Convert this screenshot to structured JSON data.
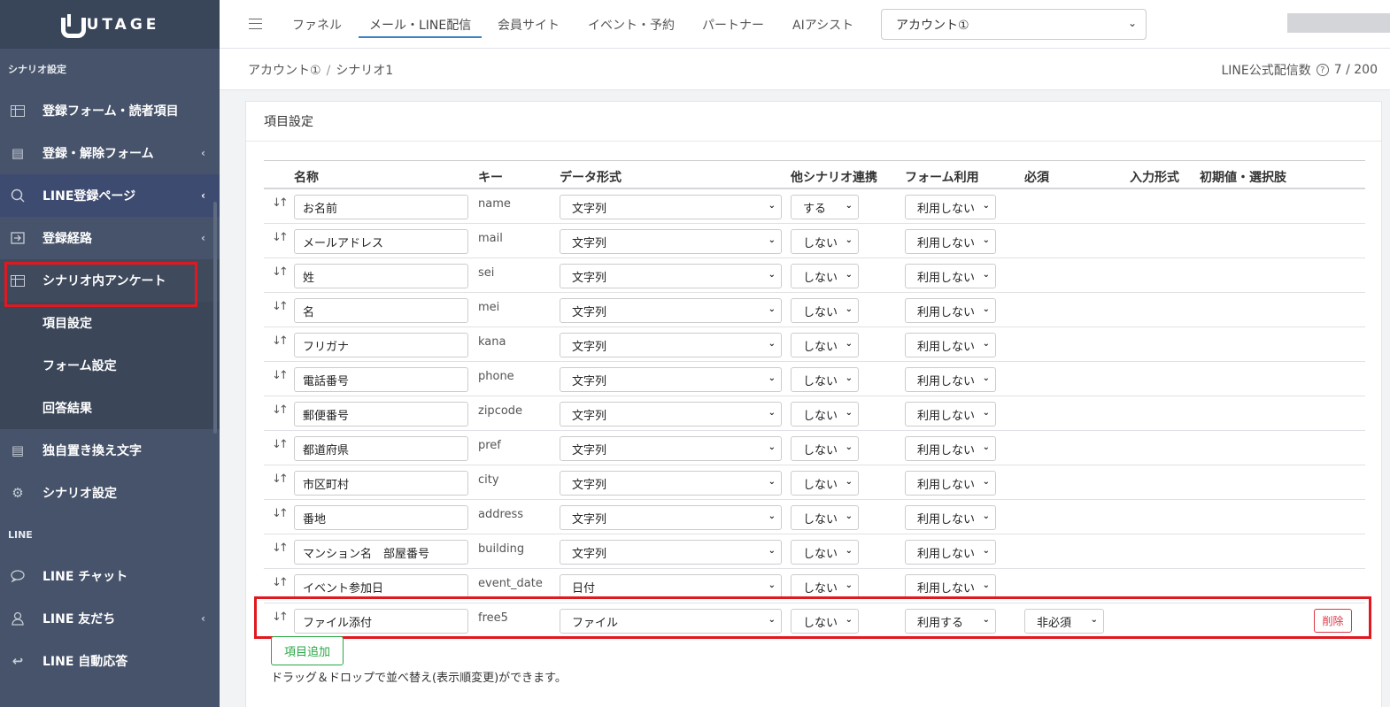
{
  "logo": {
    "text": "UTAGE"
  },
  "sidebar": {
    "section1": "シナリオ設定",
    "items": [
      {
        "label": "登録フォーム・読者項目",
        "icon": "table-icon"
      },
      {
        "label": "登録・解除フォーム",
        "icon": "form-icon",
        "chevron": "‹"
      },
      {
        "label": "LINE登録ページ",
        "icon": "search-icon",
        "chevron": "‹"
      },
      {
        "label": "登録経路",
        "icon": "login-icon",
        "chevron": "‹"
      },
      {
        "label": "シナリオ内アンケート",
        "icon": "table-icon"
      }
    ],
    "subitems": [
      "項目設定",
      "フォーム設定",
      "回答結果"
    ],
    "items2": [
      {
        "label": "独自置き換え文字",
        "icon": "doc-icon"
      },
      {
        "label": "シナリオ設定",
        "icon": "gear-icon"
      }
    ],
    "section2": "LINE",
    "items3": [
      {
        "label": "LINE チャット",
        "icon": "chat-icon"
      },
      {
        "label": "LINE 友だち",
        "icon": "user-icon",
        "chevron": "‹"
      },
      {
        "label": "LINE 自動応答",
        "icon": "reply-icon"
      }
    ]
  },
  "topnav": {
    "tabs": [
      "ファネル",
      "メール・LINE配信",
      "会員サイト",
      "イベント・予約",
      "パートナー",
      "AIアシスト"
    ],
    "active_tab": "メール・LINE配信",
    "account": "アカウント①"
  },
  "breadcrumb": {
    "root": "アカウント①",
    "sep": "/",
    "current": "シナリオ1"
  },
  "line_count": {
    "label": "LINE公式配信数",
    "help": "?",
    "value": "7 / 200"
  },
  "card": {
    "title": "項目設定",
    "headers": {
      "name": "名称",
      "key": "キー",
      "dtype": "データ形式",
      "link": "他シナリオ連携",
      "form": "フォーム利用",
      "required": "必須",
      "input": "入力形式",
      "initial": "初期値・選択肢"
    },
    "drag_symbol": "↓↑",
    "rows": [
      {
        "name": "お名前",
        "key": "name",
        "dtype": "文字列",
        "link": "する",
        "form": "利用しない"
      },
      {
        "name": "メールアドレス",
        "key": "mail",
        "dtype": "文字列",
        "link": "しない",
        "form": "利用しない"
      },
      {
        "name": "姓",
        "key": "sei",
        "dtype": "文字列",
        "link": "しない",
        "form": "利用しない"
      },
      {
        "name": "名",
        "key": "mei",
        "dtype": "文字列",
        "link": "しない",
        "form": "利用しない"
      },
      {
        "name": "フリガナ",
        "key": "kana",
        "dtype": "文字列",
        "link": "しない",
        "form": "利用しない"
      },
      {
        "name": "電話番号",
        "key": "phone",
        "dtype": "文字列",
        "link": "しない",
        "form": "利用しない"
      },
      {
        "name": "郵便番号",
        "key": "zipcode",
        "dtype": "文字列",
        "link": "しない",
        "form": "利用しない"
      },
      {
        "name": "都道府県",
        "key": "pref",
        "dtype": "文字列",
        "link": "しない",
        "form": "利用しない"
      },
      {
        "name": "市区町村",
        "key": "city",
        "dtype": "文字列",
        "link": "しない",
        "form": "利用しない"
      },
      {
        "name": "番地",
        "key": "address",
        "dtype": "文字列",
        "link": "しない",
        "form": "利用しない"
      },
      {
        "name": "マンション名　部屋番号",
        "key": "building",
        "dtype": "文字列",
        "link": "しない",
        "form": "利用しない"
      },
      {
        "name": "イベント参加日",
        "key": "event_date",
        "dtype": "日付",
        "link": "しない",
        "form": "利用しない"
      },
      {
        "name": "ファイル添付",
        "key": "free5",
        "dtype": "ファイル",
        "link": "しない",
        "form": "利用する",
        "required": "非必須",
        "delete": "削除"
      }
    ],
    "add_button": "項目追加",
    "hint": "ドラッグ＆ドロップで並べ替え(表示順変更)ができます。"
  },
  "colors": {
    "sidebar": "#46536a",
    "highlight": "#e0181f",
    "accent": "#3b82c4",
    "add": "#28a745",
    "delete": "#dc3545"
  }
}
